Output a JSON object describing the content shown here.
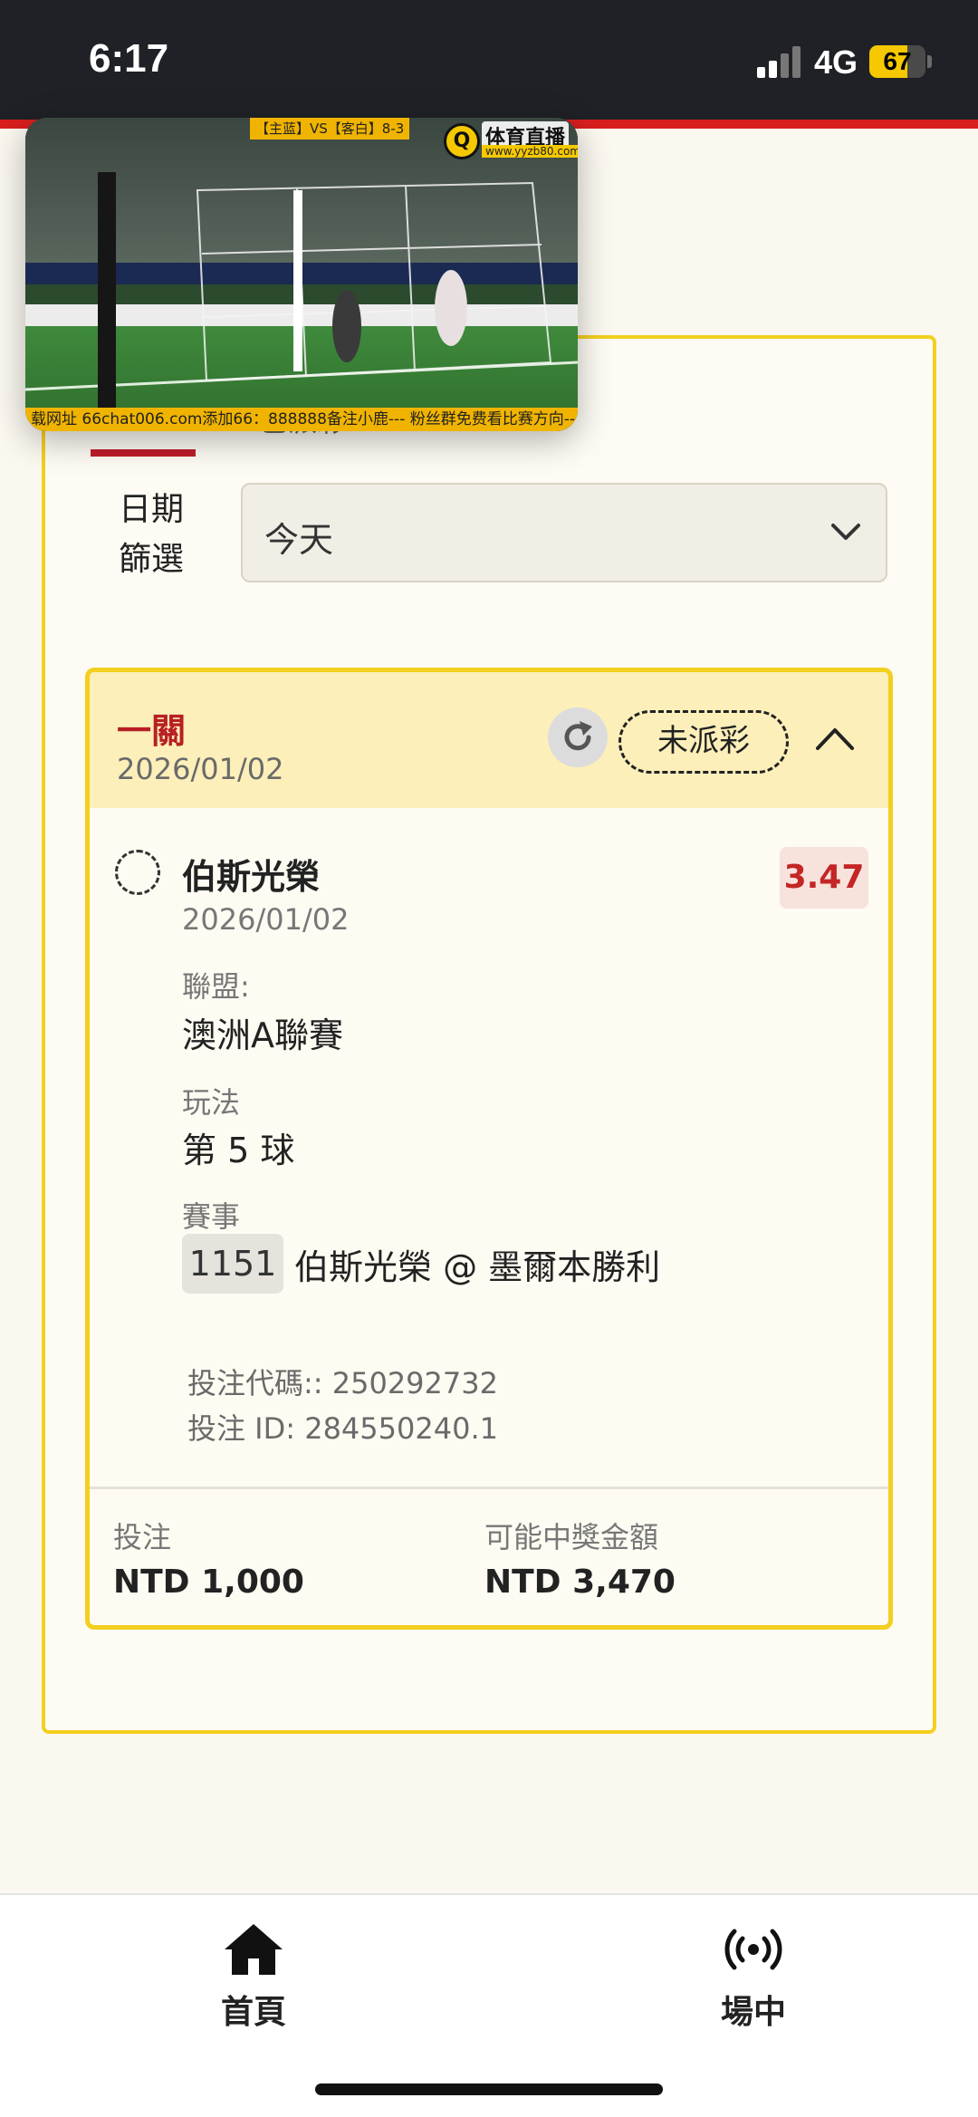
{
  "status_bar": {
    "time": "6:17",
    "network": "4G",
    "battery_percent": "67",
    "battery_level": 0.67
  },
  "video_pip": {
    "top_label": "【主蓝】VS【客白】8-3",
    "logo_text": "体育直播",
    "logo_url": "www.yyzb80.com",
    "ticker": "载网址 66chat006.com添加66：888888备注小鹿--- 粉丝群免费看比赛方向--"
  },
  "filter": {
    "tab_partial": "已派彩",
    "label": "日期\n篩選",
    "selected": "今天"
  },
  "bet": {
    "type": "一關",
    "date": "2026/01/02",
    "status": "未派彩",
    "selection": {
      "team": "伯斯光榮",
      "date": "2026/01/02",
      "odds": "3.47",
      "league_label": "聯盟:",
      "league": "澳洲A聯賽",
      "play_label": "玩法",
      "play": "第 5 球",
      "event_label": "賽事",
      "event_id": "1151",
      "event_name": "伯斯光榮 @ 墨爾本勝利"
    },
    "bet_code": "投注代碼:: 250292732",
    "bet_id": "投注 ID: 284550240.1",
    "stake_label": "投注",
    "stake": "NTD 1,000",
    "payout_label": "可能中獎金額",
    "payout": "NTD 3,470"
  },
  "nav": {
    "home": "首頁",
    "live": "場中"
  },
  "icons": {
    "home": "home-icon",
    "live": "broadcast-icon",
    "refresh": "refresh-icon",
    "collapse": "chevron-up-icon",
    "dropdown": "chevron-down-icon"
  },
  "colors": {
    "accent_red": "#c01d2a",
    "card_border": "#f3cf1f",
    "header_bg": "#fcefb9",
    "odds_red": "#c42525"
  }
}
